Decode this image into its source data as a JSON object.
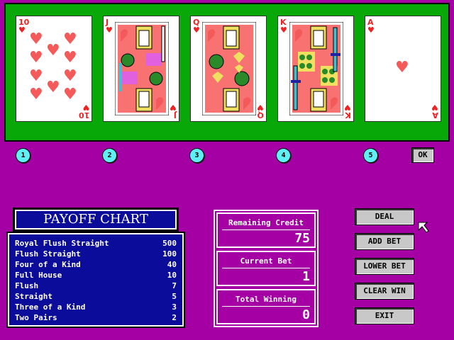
{
  "cards": [
    {
      "rank": "10",
      "suit": "♥"
    },
    {
      "rank": "J",
      "suit": "♥"
    },
    {
      "rank": "Q",
      "suit": "♥"
    },
    {
      "rank": "K",
      "suit": "♥"
    },
    {
      "rank": "A",
      "suit": "♥"
    }
  ],
  "selectors": [
    "1",
    "2",
    "3",
    "4",
    "5"
  ],
  "ok_label": "OK",
  "payoff": {
    "title": "PAYOFF  CHART",
    "rows": [
      {
        "hand": "Royal Flush Straight",
        "pay": "500"
      },
      {
        "hand": "Flush Straight",
        "pay": "100"
      },
      {
        "hand": "Four of a Kind",
        "pay": "40"
      },
      {
        "hand": "Full House",
        "pay": "10"
      },
      {
        "hand": "Flush",
        "pay": "7"
      },
      {
        "hand": "Straight",
        "pay": "5"
      },
      {
        "hand": "Three of a Kind",
        "pay": "3"
      },
      {
        "hand": "Two Pairs",
        "pay": "2"
      }
    ]
  },
  "info": {
    "remaining_credit_label": "Remaining Credit",
    "remaining_credit": "75",
    "current_bet_label": "Current Bet",
    "current_bet": "1",
    "total_winning_label": "Total Winning",
    "total_winning": "0"
  },
  "actions": {
    "deal": "DEAL",
    "add_bet": "ADD BET",
    "lower_bet": "LOWER BET",
    "clear_win": "CLEAR WIN",
    "exit": "EXIT"
  },
  "colors": {
    "background": "#a400a4",
    "table": "#08a808",
    "payoff_panel": "#0c0c9a",
    "heart": "#f45a5a",
    "selector": "#5ff0f5"
  }
}
